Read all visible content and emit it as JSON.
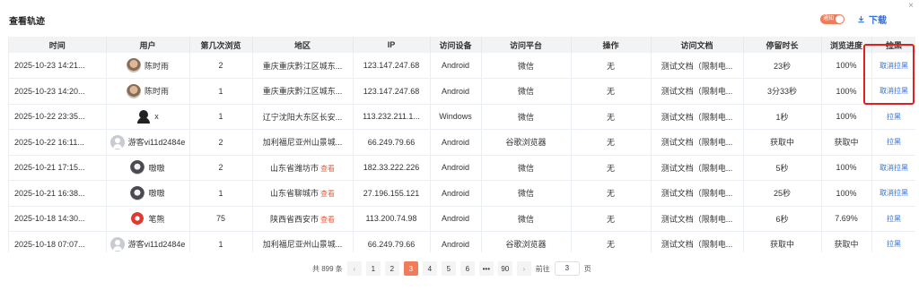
{
  "dialog": {
    "title": "查看轨迹"
  },
  "toolbar": {
    "toggle_label": "通知",
    "download_label": "下载"
  },
  "table": {
    "columns": [
      "时间",
      "用户",
      "第几次浏览",
      "地区",
      "IP",
      "访问设备",
      "访问平台",
      "操作",
      "访问文档",
      "停留时长",
      "浏览进度",
      "拉黑"
    ],
    "rows": [
      {
        "time": "2025-10-23 14:21...",
        "user": "陈时雨",
        "avatar": "photo",
        "visit": "2",
        "region": "重庆重庆黔江区城东...",
        "ip": "123.147.247.68",
        "device": "Android",
        "platform": "微信",
        "op": "无",
        "doc": "测试文档（限制电...",
        "duration": "23秒",
        "progress": "100%",
        "action": "取消拉黑"
      },
      {
        "time": "2025-10-23 14:20...",
        "user": "陈时雨",
        "avatar": "photo",
        "visit": "1",
        "region": "重庆重庆黔江区城东...",
        "ip": "123.147.247.68",
        "device": "Android",
        "platform": "微信",
        "op": "无",
        "doc": "测试文档（限制电...",
        "duration": "3分33秒",
        "progress": "100%",
        "action": "取消拉黑"
      },
      {
        "time": "2025-10-22 23:35...",
        "user": "x",
        "avatar": "black",
        "visit": "1",
        "region": "辽宁沈阳大东区长安...",
        "ip": "113.232.211.1...",
        "device": "Windows",
        "platform": "微信",
        "op": "无",
        "doc": "测试文档（限制电...",
        "duration": "1秒",
        "progress": "100%",
        "action": "拉黑"
      },
      {
        "time": "2025-10-22 16:11...",
        "user": "游客vi11d2484e",
        "avatar": "grey",
        "visit": "2",
        "region": "加利福尼亚州山景城...",
        "ip": "66.249.79.66",
        "device": "Android",
        "platform": "谷歌浏览器",
        "op": "无",
        "doc": "测试文档（限制电...",
        "duration": "获取中",
        "progress": "获取中",
        "action": "拉黑"
      },
      {
        "time": "2025-10-21 17:15...",
        "user": "嗷嗷",
        "avatar": "dark",
        "visit": "2",
        "region": "山东省潍坊市",
        "region_link": "查看",
        "ip": "182.33.222.226",
        "device": "Android",
        "platform": "微信",
        "op": "无",
        "doc": "测试文档（限制电...",
        "duration": "5秒",
        "progress": "100%",
        "action": "取消拉黑"
      },
      {
        "time": "2025-10-21 16:38...",
        "user": "嗷嗷",
        "avatar": "dark",
        "visit": "1",
        "region": "山东省聊城市",
        "region_link": "查看",
        "ip": "27.196.155.121",
        "device": "Android",
        "platform": "微信",
        "op": "无",
        "doc": "测试文档（限制电...",
        "duration": "25秒",
        "progress": "100%",
        "action": "取消拉黑"
      },
      {
        "time": "2025-10-18 14:30...",
        "user": "笔熊",
        "avatar": "red",
        "visit": "75",
        "region": "陕西省西安市",
        "region_link": "查看",
        "ip": "113.200.74.98",
        "device": "Android",
        "platform": "微信",
        "op": "无",
        "doc": "测试文档（限制电...",
        "duration": "6秒",
        "progress": "7.69%",
        "action": "拉黑"
      },
      {
        "time": "2025-10-18 07:07...",
        "user": "游客vi11d2484e",
        "avatar": "grey",
        "visit": "1",
        "region": "加利福尼亚州山景城...",
        "ip": "66.249.79.66",
        "device": "Android",
        "platform": "谷歌浏览器",
        "op": "无",
        "doc": "测试文档（限制电...",
        "duration": "获取中",
        "progress": "获取中",
        "action": "拉黑"
      }
    ]
  },
  "pagination": {
    "total_text": "共 899 条",
    "prev": "‹",
    "pages": [
      "1",
      "2",
      "3",
      "4",
      "5",
      "6",
      "•••",
      "90"
    ],
    "current": "3",
    "next": "›",
    "goto_label": "前往",
    "goto_value": "3",
    "page_unit": "页"
  },
  "colors": {
    "accent": "#f07c5a",
    "link": "#2f6fe0",
    "highlight_border": "#e02020"
  },
  "icons": {
    "close": "close-icon",
    "download": "download-icon"
  }
}
